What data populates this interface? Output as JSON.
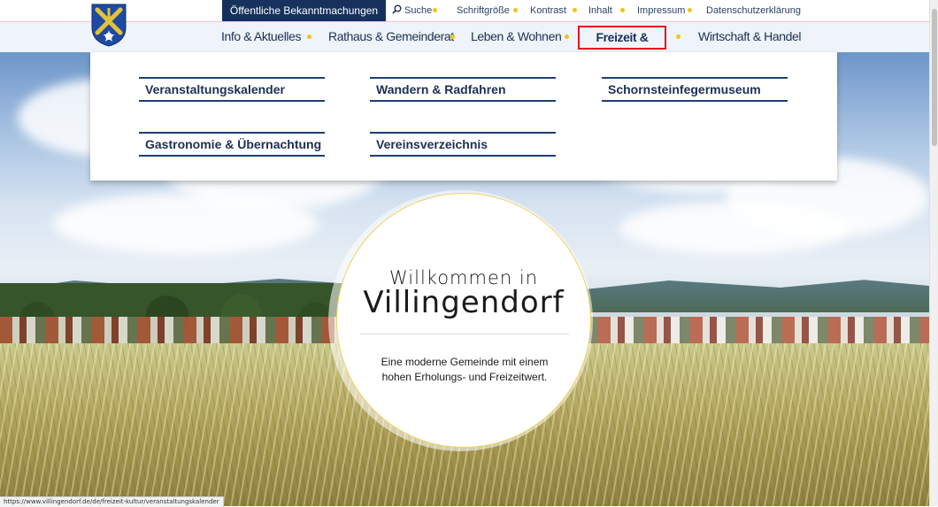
{
  "header": {
    "announcements_label": "Öffentliche Bekanntmachungen",
    "utility": {
      "search": "Suche",
      "font_size": "Schriftgröße",
      "contrast": "Kontrast",
      "contents": "Inhalt",
      "imprint": "Impressum",
      "privacy": "Datenschutzerklärung"
    }
  },
  "nav": {
    "info": "Info & Aktuelles",
    "rathaus": "Rathaus & Gemeinderat",
    "leben": "Leben & Wohnen",
    "freizeit": "Freizeit & Kultur",
    "wirtschaft": "Wirtschaft & Handel"
  },
  "mega_menu": {
    "veranstaltung": "Veranstaltungskalender",
    "wandern": "Wandern & Radfahren",
    "museum": "Schornsteinfegermuseum",
    "gastronomie": "Gastronomie & Übernachtung",
    "verein": "Vereinsverzeichnis"
  },
  "welcome": {
    "line1": "Willkommen in",
    "line2": "Villingendorf",
    "text": "Eine moderne Gemeinde mit einem hohen Erholungs- und Freizeitwert."
  },
  "status_url": "https://www.villingendorf.de/de/freizeit-kultur/veranstaltungskalender",
  "colors": {
    "navy": "#16325c",
    "accent_yellow": "#f0c419",
    "highlight_red": "#e0141d"
  },
  "icons": {
    "search": "search-icon",
    "logo": "coat-of-arms-logo"
  }
}
